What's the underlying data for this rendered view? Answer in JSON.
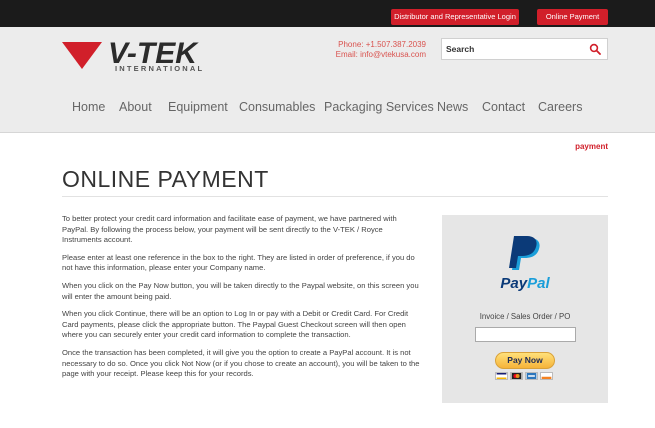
{
  "topbar": {
    "distributor_login": "Distributor and Representative Login",
    "online_payment": "Online Payment"
  },
  "brand": {
    "name": "V-TEK",
    "tagline": "INTERNATIONAL",
    "accent": "#d11f2a"
  },
  "contact": {
    "phone": "Phone: +1.507.387.2039",
    "email": "Email: info@vtekusa.com"
  },
  "search": {
    "placeholder": "Search"
  },
  "nav": {
    "items": [
      "Home",
      "About",
      "Equipment",
      "Consumables",
      "Packaging Services",
      "News",
      "Contact",
      "Careers"
    ]
  },
  "breadcrumb": "payment",
  "page": {
    "title": "ONLINE PAYMENT",
    "paragraphs": [
      "To better protect your credit card information and facilitate ease of payment, we have partnered with PayPal. By following the process below, your payment will be sent directly to the V-TEK / Royce Instruments account.",
      "Please enter at least one reference in the box to the right. They are listed in order of preference, if you do not have this information, please enter your Company name.",
      "When you click on the Pay Now button, you will be taken directly to the Paypal website, on this screen you will enter the amount being paid.",
      "When you click Continue, there will be an option to Log In or pay with a Debit or Credit Card. For Credit Card payments, please click the appropriate button. The Paypal Guest Checkout screen will then open where you can securely enter your credit card information to complete the transaction.",
      "Once the transaction has been completed, it will give you the option to create a PayPal account. It is not necessary to do so. Once you click Not Now (or if you chose to create an account), you will be taken to the page with your receipt. Please keep this for your records."
    ]
  },
  "paypal": {
    "word_pay": "Pay",
    "word_pal": "Pal",
    "reference_label": "Invoice / Sales Order / PO",
    "reference_value": "",
    "pay_now": "Pay Now",
    "card_icons": [
      "visa-card-icon",
      "mastercard-icon",
      "amex-card-icon",
      "discover-card-icon"
    ]
  }
}
